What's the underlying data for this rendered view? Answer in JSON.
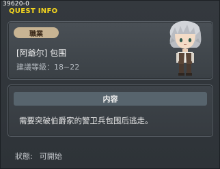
{
  "window": {
    "quest_id": "39620-0",
    "title": "QUEST INFO"
  },
  "quest": {
    "job_badge": "職業",
    "name": "[阿爺尔] 包围",
    "level_label": "建議等級：",
    "level_range": "18~22"
  },
  "content": {
    "header": "内容",
    "description": "需要突破伯爵家的警卫兵包围后逃走。"
  },
  "status": {
    "label": "狀態:",
    "value": "可開始"
  },
  "colors": {
    "title_yellow": "#f5d61e",
    "badge_bg": "#c8b493",
    "header_bg": "#57646d"
  }
}
